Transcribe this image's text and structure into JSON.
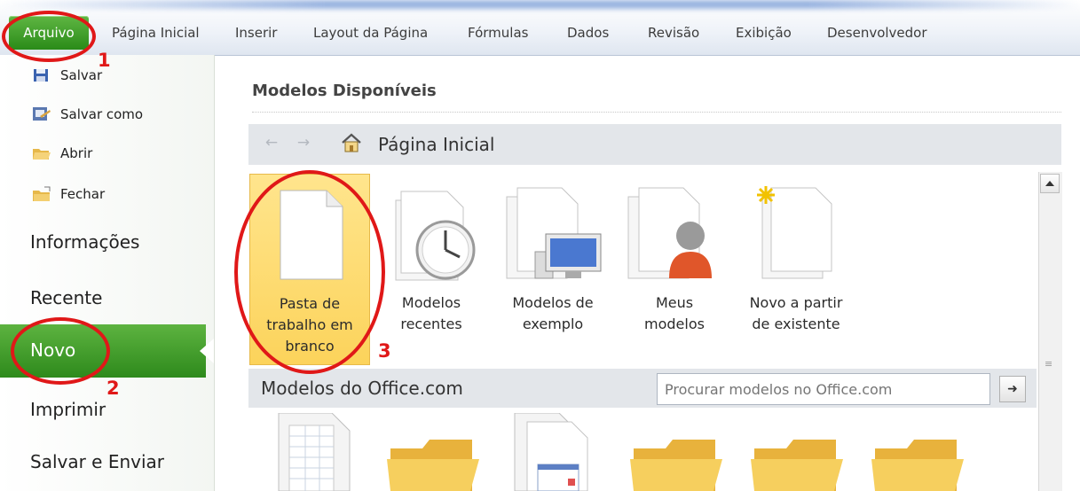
{
  "ribbon": {
    "tabs": [
      "Arquivo",
      "Página Inicial",
      "Inserir",
      "Layout da Página",
      "Fórmulas",
      "Dados",
      "Revisão",
      "Exibição",
      "Desenvolvedor"
    ]
  },
  "backstage": {
    "commands": [
      "Salvar",
      "Salvar como",
      "Abrir",
      "Fechar"
    ],
    "sections": [
      "Informações",
      "Recente",
      "Novo",
      "Imprimir",
      "Salvar e Enviar"
    ],
    "selected": "Novo"
  },
  "main": {
    "heading": "Modelos Disponíveis",
    "breadcrumb": "Página Inicial",
    "templates": [
      {
        "label": "Pasta de\ntrabalho em\nbranco",
        "icon": "blank-workbook-icon",
        "selected": true
      },
      {
        "label": "Modelos\nrecentes",
        "icon": "recent-templates-icon"
      },
      {
        "label": "Modelos de\nexemplo",
        "icon": "sample-templates-icon"
      },
      {
        "label": "Meus\nmodelos",
        "icon": "my-templates-icon"
      },
      {
        "label": "Novo a partir\nde existente",
        "icon": "new-from-existing-icon"
      }
    ],
    "office_section": "Modelos do Office.com",
    "search_placeholder": "Procurar modelos no Office.com"
  },
  "annotations": [
    "1",
    "2",
    "3"
  ],
  "colors": {
    "file_tab": "#2a8b18",
    "selected_nav": "#3c9a27",
    "selected_tile": "#fcd35b",
    "annotation": "#e01818"
  }
}
